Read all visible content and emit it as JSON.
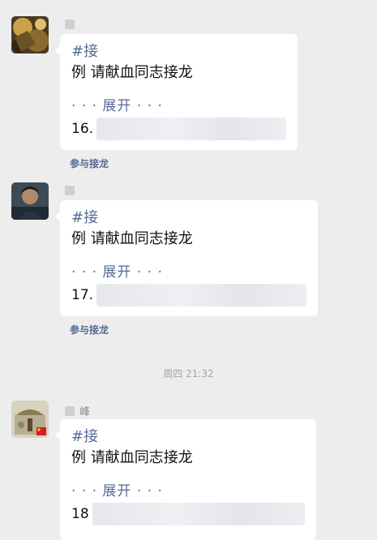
{
  "messages": [
    {
      "hashtag": "#接",
      "body": "例 请献血同志接龙",
      "expand": "· · · 展开 · · ·",
      "entry": "16.",
      "join": "参与接龙"
    },
    {
      "hashtag": "#接",
      "body": "例 请献血同志接龙",
      "expand": "· · · 展开 · · ·",
      "entry": "17.",
      "join": "参与接龙"
    },
    {
      "name_suffix": "峰",
      "hashtag": "#接",
      "body": "例 请献血同志接龙",
      "expand": "· · · 展开 · · ·",
      "entry": "18"
    }
  ],
  "timestamp": "周四 21:32",
  "colors": {
    "background": "#ededed",
    "bubble": "#ffffff",
    "link": "#576b95",
    "timestamp": "#a3a3a3"
  }
}
